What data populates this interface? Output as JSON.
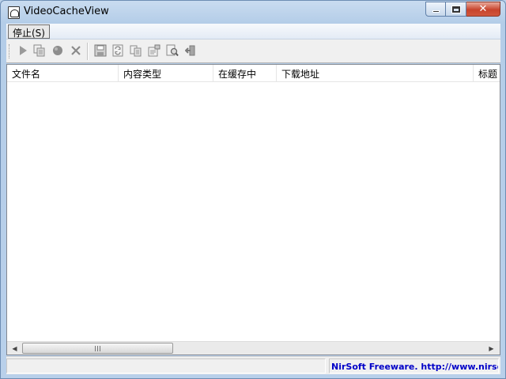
{
  "window": {
    "title": "VideoCacheView",
    "caption_buttons": [
      "minimize",
      "maximize",
      "close"
    ]
  },
  "menu": {
    "items": [
      {
        "label": "停止(S)"
      }
    ]
  },
  "toolbar": {
    "icons": [
      "play-icon",
      "copy-files-icon",
      "record-icon",
      "stop-icon",
      "save-icon",
      "refresh-icon",
      "copy-icon",
      "properties-icon",
      "find-icon",
      "exit-icon"
    ]
  },
  "list": {
    "columns": [
      {
        "label": "文件名"
      },
      {
        "label": "内容类型"
      },
      {
        "label": "在缓存中"
      },
      {
        "label": "下载地址"
      },
      {
        "label": "标题"
      }
    ],
    "rows": []
  },
  "statusbar": {
    "items_text": "",
    "link_text": "NirSoft Freeware.  http://www.nirsoft.net"
  },
  "colors": {
    "link": "#0000c8",
    "close_button": "#c7442c"
  }
}
